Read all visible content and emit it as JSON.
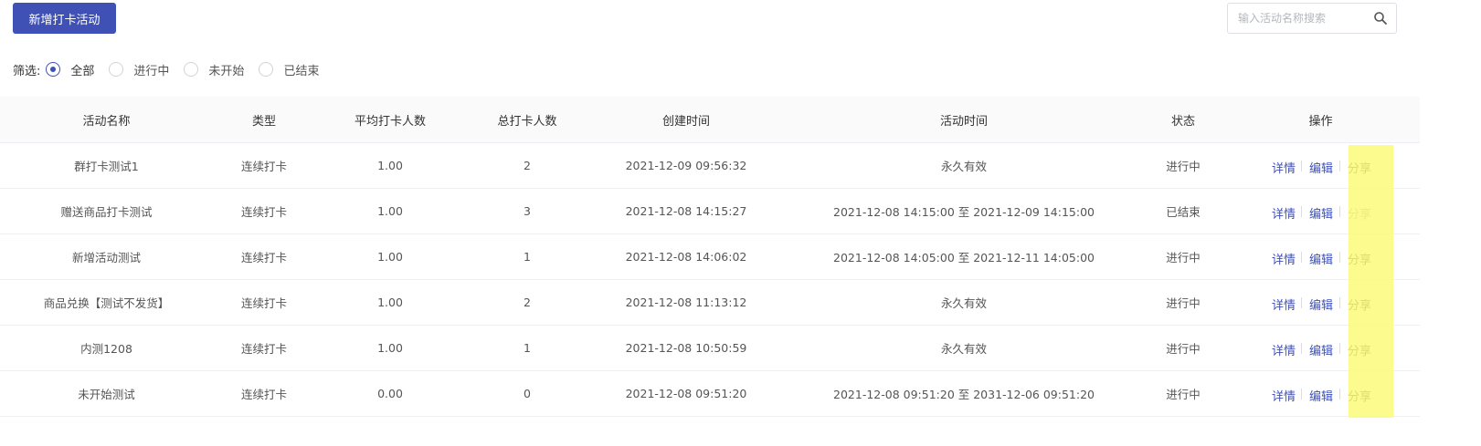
{
  "toolbar": {
    "add_label": "新增打卡活动"
  },
  "search": {
    "placeholder": "输入活动名称搜索",
    "value": ""
  },
  "filter": {
    "label": "筛选:",
    "options": [
      {
        "label": "全部",
        "selected": true
      },
      {
        "label": "进行中",
        "selected": false
      },
      {
        "label": "未开始",
        "selected": false
      },
      {
        "label": "已结束",
        "selected": false
      }
    ]
  },
  "table": {
    "headers": [
      "活动名称",
      "类型",
      "平均打卡人数",
      "总打卡人数",
      "创建时间",
      "活动时间",
      "状态",
      "操作"
    ],
    "rows": [
      {
        "name": "群打卡测试1",
        "type": "连续打卡",
        "avg": "1.00",
        "total": "2",
        "created": "2021-12-09 09:56:32",
        "period": "永久有效",
        "status": "进行中"
      },
      {
        "name": "赠送商品打卡测试",
        "type": "连续打卡",
        "avg": "1.00",
        "total": "3",
        "created": "2021-12-08 14:15:27",
        "period": "2021-12-08 14:15:00 至 2021-12-09 14:15:00",
        "status": "已结束"
      },
      {
        "name": "新增活动测试",
        "type": "连续打卡",
        "avg": "1.00",
        "total": "1",
        "created": "2021-12-08 14:06:02",
        "period": "2021-12-08 14:05:00 至 2021-12-11 14:05:00",
        "status": "进行中"
      },
      {
        "name": "商品兑换【测试不发货】",
        "type": "连续打卡",
        "avg": "1.00",
        "total": "2",
        "created": "2021-12-08 11:13:12",
        "period": "永久有效",
        "status": "进行中"
      },
      {
        "name": "内测1208",
        "type": "连续打卡",
        "avg": "1.00",
        "total": "1",
        "created": "2021-12-08 10:50:59",
        "period": "永久有效",
        "status": "进行中"
      },
      {
        "name": "未开始测试",
        "type": "连续打卡",
        "avg": "0.00",
        "total": "0",
        "created": "2021-12-08 09:51:20",
        "period": "2021-12-08 09:51:20 至 2031-12-06 09:51:20",
        "status": "进行中"
      }
    ],
    "actions": {
      "detail": "详情",
      "edit": "编辑",
      "share": "分享"
    }
  },
  "colors": {
    "accent": "#3f51b5",
    "highlight": "#fafa7a",
    "header_bg": "#fafafa"
  }
}
